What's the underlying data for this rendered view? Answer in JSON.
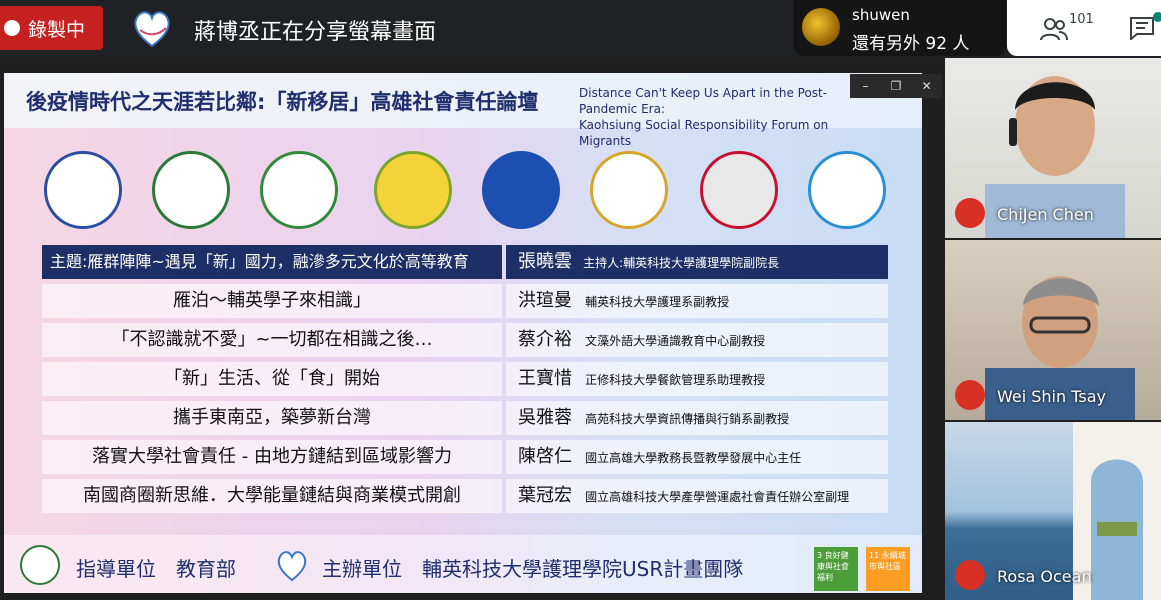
{
  "topbar": {
    "recording_label": "錄製中",
    "sharing_text": "蔣博丞正在分享螢幕畫面",
    "viewer_name": "shuwen",
    "viewer_more": "還有另外 92 人",
    "participant_count": "101"
  },
  "window_controls": {
    "minimize": "–",
    "restore": "❐",
    "close": "✕"
  },
  "slide": {
    "title_zh": "後疫情時代之天涯若比鄰:「新移居」高雄社會責任論壇",
    "title_en_1": "Distance Can't Keep Us Apart in the Post-Pandemic Era:",
    "title_en_2": "Kaohsiung Social Responsibility Forum on Migrants",
    "theme": "主題:雁群陣陣~遇見「新」國力，融滲多元文化於高等教育",
    "host_name": "張曉雲",
    "host_role": "主持人:輔英科技大學護理學院副院長",
    "rows": [
      {
        "topic": "雁泊～輔英學子來相識」",
        "name": "洪瑄曼",
        "role": "輔英科技大學護理系副教授"
      },
      {
        "topic": "「不認識就不愛」~一切都在相識之後…",
        "name": "蔡介裕",
        "role": "文藻外語大學通識教育中心副教授"
      },
      {
        "topic": "「新」生活、從「食」開始",
        "name": "王寶惜",
        "role": "正修科技大學餐飲管理系助理教授"
      },
      {
        "topic": "攜手東南亞，築夢新台灣",
        "name": "吳雅蓉",
        "role": "高苑科技大學資訊傳播與行銷系副教授"
      },
      {
        "topic": "落實大學社會責任 - 由地方鏈結到區域影響力",
        "name": "陳啓仁",
        "role": "國立高雄大學教務長暨教學發展中心主任"
      },
      {
        "topic": "南國商圈新思維．大學能量鏈結與商業模式開創",
        "name": "葉冠宏",
        "role": "國立高雄科技大學產學營運處社會責任辦公室副理"
      }
    ],
    "footer_guide": "指導單位　教育部",
    "footer_host": "主辦單位　輔英科技大學護理學院USR計畫團隊",
    "sdg3_label": "3 良好健康與社會福利",
    "sdg11_label": "11 永續城市與社區"
  },
  "participants": [
    {
      "name": "ChiJen Chen"
    },
    {
      "name": "Wei Shin Tsay"
    },
    {
      "name": "Rosa Ocean"
    }
  ]
}
